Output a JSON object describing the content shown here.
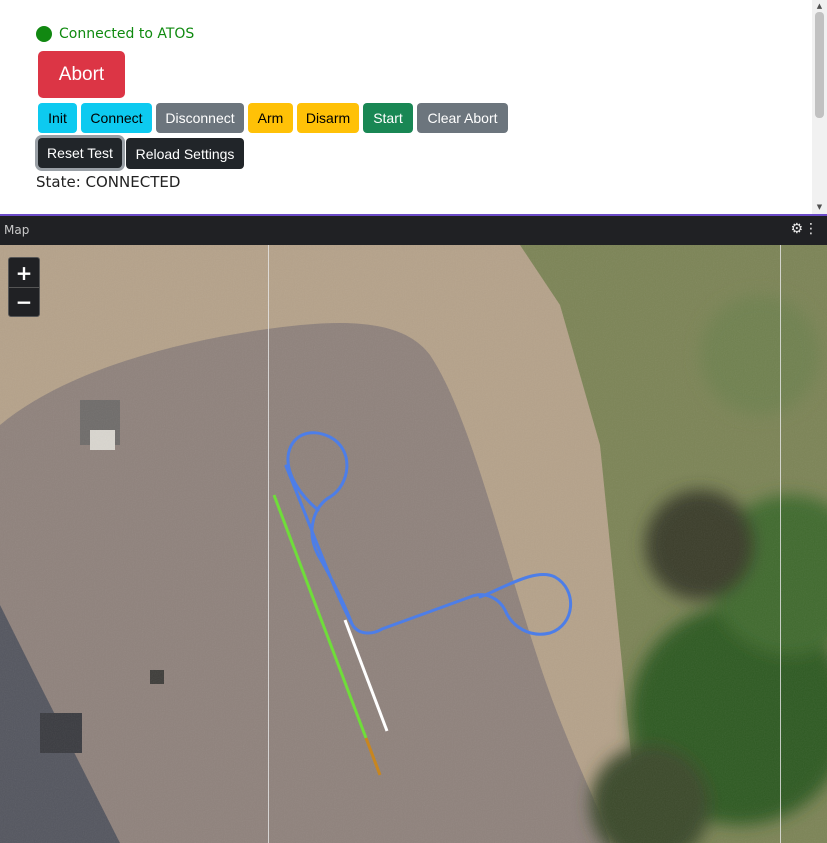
{
  "connection": {
    "status_text": "Connected to ATOS",
    "indicator_color": "#118811"
  },
  "controls": {
    "abort_label": "Abort",
    "buttons": [
      {
        "key": "init",
        "label": "Init",
        "variant": "info"
      },
      {
        "key": "connect",
        "label": "Connect",
        "variant": "info"
      },
      {
        "key": "disconnect",
        "label": "Disconnect",
        "variant": "secondary"
      },
      {
        "key": "arm",
        "label": "Arm",
        "variant": "warning"
      },
      {
        "key": "disarm",
        "label": "Disarm",
        "variant": "warning"
      },
      {
        "key": "start",
        "label": "Start",
        "variant": "success"
      },
      {
        "key": "clear_abort",
        "label": "Clear Abort",
        "variant": "secondary"
      }
    ],
    "reset_test_label": "Reset Test",
    "reload_settings_label": "Reload Settings"
  },
  "state_text": "State: CONNECTED",
  "panel": {
    "title": "Map",
    "gear_icon": "gear-icon",
    "menu_icon": "kebab-menu-icon"
  },
  "map": {
    "zoom_in_label": "+",
    "zoom_out_label": "−",
    "trajectory_colors": {
      "planned_loop": "#4d7ee8",
      "object_path_1": "#6fdd3a",
      "object_path_2": "#ffffff",
      "object_path_3": "#c8861f"
    }
  }
}
